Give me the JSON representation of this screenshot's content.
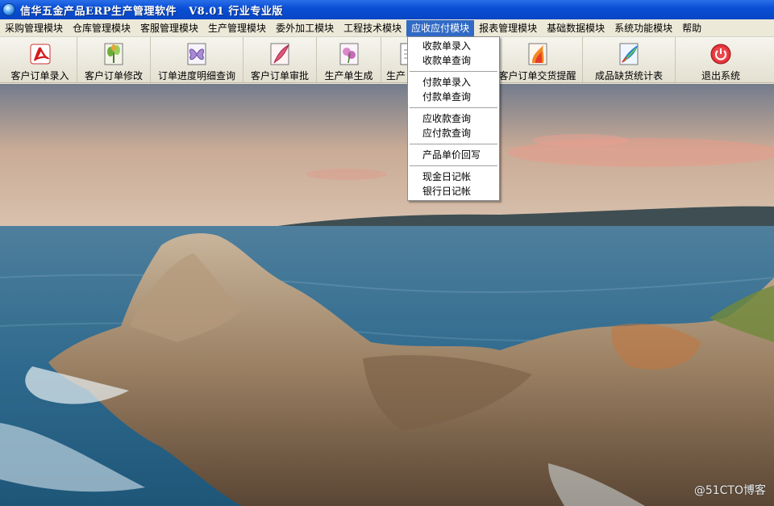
{
  "window": {
    "title": "信华五金产品ERP生产管理软件   V8.01 行业专业版"
  },
  "menu": [
    {
      "label": "采购管理模块"
    },
    {
      "label": "仓库管理模块"
    },
    {
      "label": "客服管理模块"
    },
    {
      "label": "生产管理模块"
    },
    {
      "label": "委外加工模块"
    },
    {
      "label": "工程技术模块"
    },
    {
      "label": "应收应付模块",
      "active": true
    },
    {
      "label": "报表管理模块"
    },
    {
      "label": "基础数据模块"
    },
    {
      "label": "系统功能模块"
    },
    {
      "label": "帮助"
    }
  ],
  "toolbar": [
    {
      "label": "客户订单录入",
      "icon": "pdf-icon"
    },
    {
      "label": "客户订单修改",
      "icon": "plant-icon"
    },
    {
      "label": "订单进度明细查询",
      "icon": "butterfly-icon"
    },
    {
      "label": "客户订单审批",
      "icon": "feather-icon"
    },
    {
      "label": "生产单生成",
      "icon": "flower-icon"
    },
    {
      "label": "生产",
      "icon": "document-icon"
    },
    {
      "label": "客户订单交货提醒",
      "icon": "flame-icon"
    },
    {
      "label": "成品缺货统计表",
      "icon": "quill-icon"
    },
    {
      "label": "退出系统",
      "icon": "power-icon"
    }
  ],
  "dropdown": {
    "groups": [
      [
        "收款单录入",
        "收款单查询"
      ],
      [
        "付款单录入",
        "付款单查询"
      ],
      [
        "应收款查询",
        "应付款查询"
      ],
      [
        "产品单价回写"
      ],
      [
        "现金日记帐",
        "银行日记帐"
      ]
    ]
  },
  "watermark": "@51CTO博客",
  "colors": {
    "titlebar": "#0A4FD6",
    "menu_highlight": "#316AC5",
    "chrome": "#ECE9D8"
  }
}
